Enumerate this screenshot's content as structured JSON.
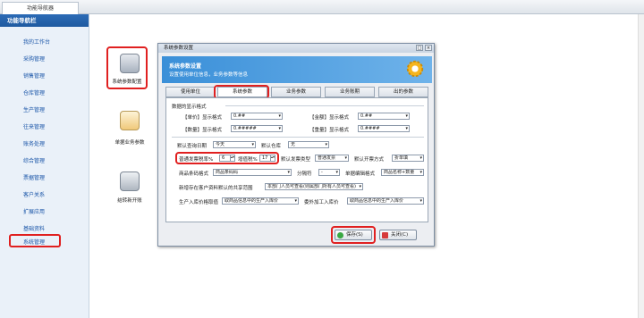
{
  "tab": {
    "label": "功能导航器"
  },
  "sidebar": {
    "header": "功能导航栏",
    "items": [
      {
        "label": "我的工作台"
      },
      {
        "label": "采购管理"
      },
      {
        "label": "销售管理"
      },
      {
        "label": "仓库管理"
      },
      {
        "label": "生产管理"
      },
      {
        "label": "往来管理"
      },
      {
        "label": "账务处理"
      },
      {
        "label": "综合管理"
      },
      {
        "label": "票据管理"
      },
      {
        "label": "客户关系"
      },
      {
        "label": "扩展应用"
      },
      {
        "label": "基础资料"
      },
      {
        "label": "系统管理"
      }
    ]
  },
  "main": {
    "icons": [
      {
        "label": "系统参数配置",
        "icon": "database-gear-icon"
      },
      {
        "label": "单据业务参数",
        "icon": "document-settings-icon"
      },
      {
        "label": "结转新开账",
        "icon": "database-green-icon"
      }
    ]
  },
  "dialog": {
    "title": "系统参数设置",
    "header_title": "系统参数设置",
    "header_sub": "设置使用单位信息，业务参数等信息",
    "tabs": [
      "使用单位",
      "系统参数",
      "业务参数",
      "业务账期",
      "出的参数"
    ],
    "section": "数据的显示格式",
    "row1": {
      "l1": "【单价】显示格式",
      "v1": "0.##",
      "l2": "【金额】显示格式",
      "v2": "0.##"
    },
    "row2": {
      "l1": "【数量】显示格式",
      "v1": "0.#####",
      "l2": "【重量】显示格式",
      "v2": "0.####"
    },
    "row3": {
      "l1": "默认查询日期",
      "v1": "今天",
      "l2": "默认仓库",
      "v2": "无"
    },
    "row4": {
      "l1": "普通发票税率%",
      "v1": "6",
      "l2": "增值税%",
      "v2": "17",
      "l3": "默认发票类型",
      "v3": "普通发票",
      "l4": "默认开票方式",
      "v4": "折单填"
    },
    "row5": {
      "l1": "商品条码格式",
      "v1": "商品条码码",
      "l2": "分隔符",
      "v2": "-",
      "l3": "单据编辑格式",
      "v3": "商品名称+数量"
    },
    "row6": {
      "l1": "新增存在客户资料默认的共享范围",
      "v1": "本部门人员可查看(则属部门所有人员可查看)"
    },
    "row7": {
      "l1": "生产入库价格取值",
      "v1": "取商品信息中的生产入库价",
      "l2": "委外加工入库价",
      "v2": "取商品信息中的生产入库价"
    },
    "buttons": {
      "save": "保存(S)",
      "close": "关闭(C)"
    }
  }
}
